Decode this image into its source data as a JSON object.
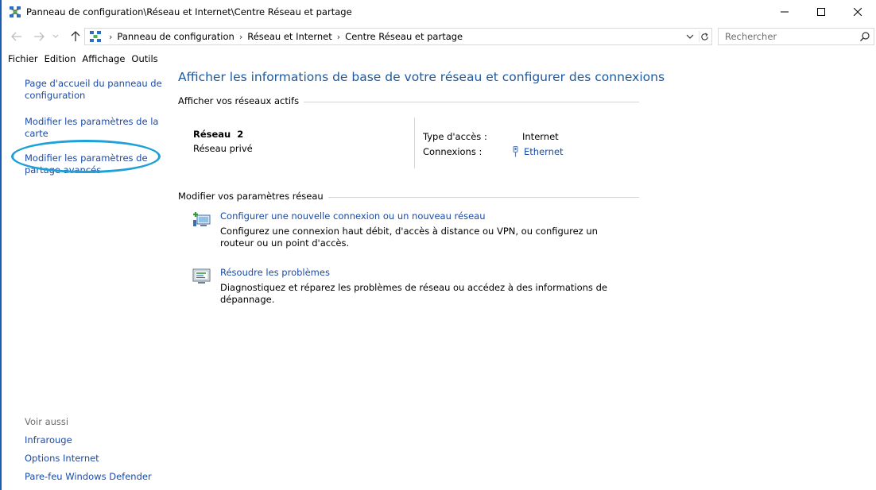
{
  "window": {
    "title": "Panneau de configuration\\Réseau et Internet\\Centre Réseau et partage",
    "icon": "network-center-icon"
  },
  "window_controls": {
    "minimize_icon": "minimize-icon",
    "maximize_icon": "maximize-icon",
    "close_icon": "close-icon"
  },
  "address_bar": {
    "breadcrumbs": [
      "Panneau de configuration",
      "Réseau et Internet",
      "Centre Réseau et partage"
    ]
  },
  "search": {
    "placeholder": "Rechercher"
  },
  "menu": {
    "items": [
      "Fichier",
      "Edition",
      "Affichage",
      "Outils"
    ]
  },
  "left_pane": {
    "links": [
      "Page d'accueil du panneau de configuration",
      "Modifier les paramètres de la carte",
      "Modifier les paramètres de partage avancés"
    ],
    "see_also": {
      "heading": "Voir aussi",
      "links": [
        "Infrarouge",
        "Options Internet",
        "Pare-feu Windows Defender"
      ]
    },
    "highlight_color": "#1ea0d8"
  },
  "main": {
    "title": "Afficher les informations de base de votre réseau et configurer des connexions",
    "active_networks": {
      "heading": "Afficher vos réseaux actifs",
      "network_name": "Réseau  2",
      "network_type": "Réseau privé",
      "access_type_label": "Type d'accès :",
      "access_type_value": "Internet",
      "connections_label": "Connexions :",
      "connections_value": "Ethernet"
    },
    "change_settings": {
      "heading": "Modifier vos paramètres réseau",
      "tasks": [
        {
          "title": "Configurer une nouvelle connexion ou un nouveau réseau",
          "description": "Configurez une connexion haut débit, d'accès à distance ou VPN, ou configurez un routeur ou un point d'accès.",
          "icon": "new-connection-icon"
        },
        {
          "title": "Résoudre les problèmes",
          "description": "Diagnostiquez et réparez les problèmes de réseau ou accédez à des informations de dépannage.",
          "icon": "troubleshoot-icon"
        }
      ]
    }
  },
  "colors": {
    "link": "#1a4aa8",
    "title": "#1e5aa0",
    "accent_edge": "#1a5fb4"
  }
}
